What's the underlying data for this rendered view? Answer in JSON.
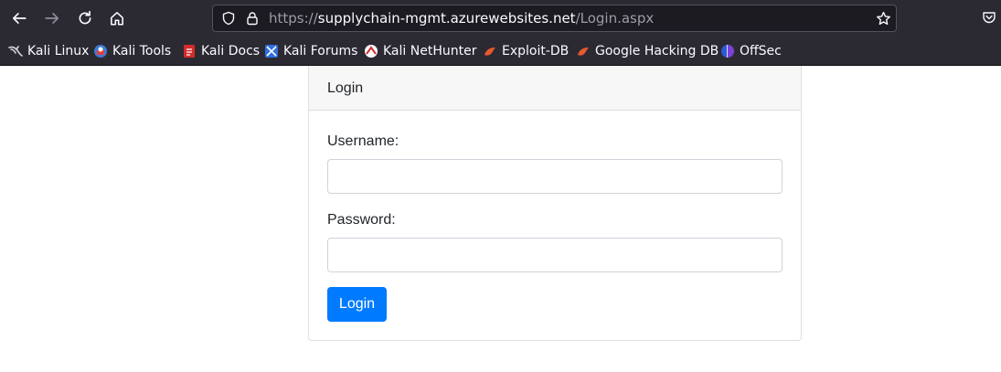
{
  "browser": {
    "url": {
      "scheme": "https://",
      "host": "supplychain-mgmt.azurewebsites.net",
      "path": "/Login.aspx"
    },
    "bookmarks": [
      {
        "label": "Kali Linux",
        "icon": "kali-dragon-icon"
      },
      {
        "label": "Kali Tools",
        "icon": "kali-tools-icon"
      },
      {
        "label": "Kali Docs",
        "icon": "kali-docs-icon"
      },
      {
        "label": "Kali Forums",
        "icon": "kali-forums-icon"
      },
      {
        "label": "Kali NetHunter",
        "icon": "kali-nethunter-icon"
      },
      {
        "label": "Exploit-DB",
        "icon": "exploit-db-icon"
      },
      {
        "label": "Google Hacking DB",
        "icon": "exploit-db-icon"
      },
      {
        "label": "OffSec",
        "icon": "offsec-icon"
      }
    ]
  },
  "login": {
    "title": "Login",
    "username_label": "Username:",
    "username_value": "",
    "password_label": "Password:",
    "password_value": "",
    "submit_label": "Login"
  },
  "colors": {
    "chrome_bg": "#2b2a33",
    "urlbar_bg": "#1c1b22",
    "primary_button": "#007bff"
  }
}
